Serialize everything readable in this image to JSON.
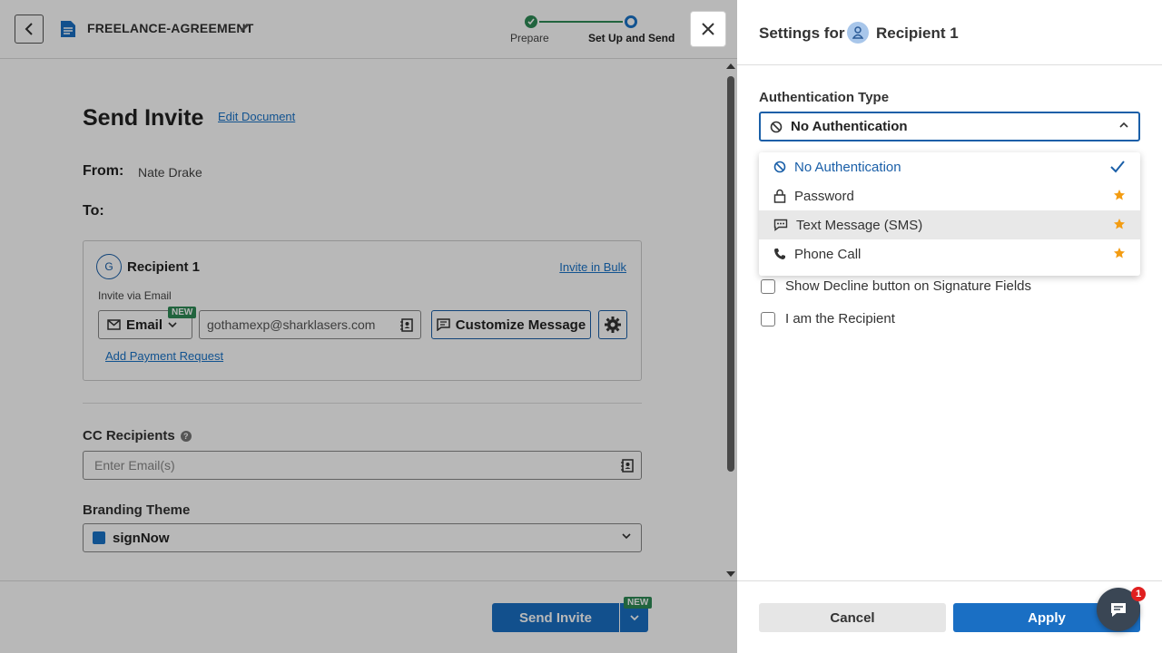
{
  "header": {
    "doc_title": "FREELANCE-AGREEMENT",
    "steps": [
      {
        "label": "Prepare",
        "state": "done"
      },
      {
        "label": "Set Up and Send",
        "state": "current"
      }
    ]
  },
  "main": {
    "heading": "Send Invite",
    "edit_link": "Edit Document",
    "from_label": "From:",
    "from_value": "Nate Drake",
    "to_label": "To:",
    "recipient": {
      "avatar_letter": "G",
      "name": "Recipient 1",
      "invite_bulk": "Invite in Bulk",
      "invite_via": "Invite via Email",
      "method": "Email",
      "new_badge": "NEW",
      "email": "gothamexp@sharklasers.com",
      "customize": "Customize Message",
      "add_payment": "Add Payment Request"
    },
    "cc_label": "CC Recipients",
    "cc_placeholder": "Enter Email(s)",
    "branding_label": "Branding Theme",
    "branding_value": "signNow",
    "branding_color": "#1a73c8"
  },
  "footer": {
    "send_label": "Send Invite",
    "new_badge": "NEW"
  },
  "panel": {
    "settings_for": "Settings for",
    "recipient_name": "Recipient 1",
    "auth_label": "Authentication Type",
    "auth_selected": "No Authentication",
    "options": [
      {
        "label": "No Authentication",
        "icon": "no-entry-icon",
        "selected": true
      },
      {
        "label": "Password",
        "icon": "lock-icon",
        "premium": true
      },
      {
        "label": "Text Message (SMS)",
        "icon": "sms-icon",
        "premium": true,
        "hovered": true
      },
      {
        "label": "Phone Call",
        "icon": "phone-icon",
        "premium": true
      }
    ],
    "checkboxes": [
      {
        "label": "Show Decline button on Signature Fields",
        "checked": false
      },
      {
        "label": "I am the Recipient",
        "checked": false
      }
    ],
    "cancel_label": "Cancel",
    "apply_label": "Apply"
  },
  "chat": {
    "badge_count": "1"
  },
  "colors": {
    "accent": "#1a6fc4",
    "success": "#2e8b57",
    "premium_star": "#f39c12"
  }
}
